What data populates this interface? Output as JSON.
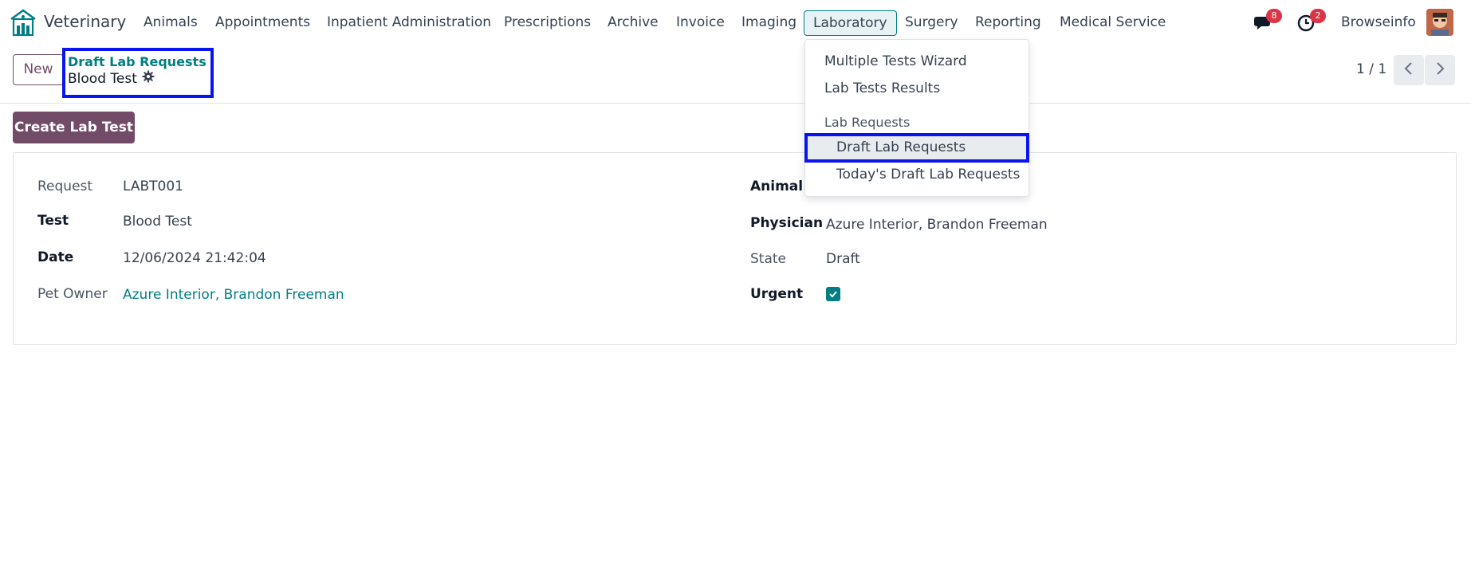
{
  "navbar": {
    "app_name": "Veterinary",
    "menu": [
      "Animals",
      "Appointments",
      "Inpatient Administration",
      "Prescriptions",
      "Archive",
      "Invoice",
      "Imaging",
      "Laboratory",
      "Surgery",
      "Reporting",
      "Medical Service"
    ],
    "active_menu": "Laboratory",
    "messages_count": "8",
    "activities_count": "2",
    "company": "Browseinfo"
  },
  "control_panel": {
    "new_label": "New",
    "breadcrumb_parent": "Draft Lab Requests",
    "breadcrumb_current": "Blood Test",
    "pager": "1 / 1"
  },
  "actions": {
    "create_lab_test": "Create Lab Test"
  },
  "form": {
    "request_label": "Request",
    "request_value": "LABT001",
    "test_label": "Test",
    "test_value": "Blood Test",
    "date_label": "Date",
    "date_value": "12/06/2024 21:42:04",
    "pet_owner_label": "Pet Owner",
    "pet_owner_value": "Azure Interior, Brandon Freeman",
    "animal_label": "Animal",
    "physician_label": "Physician",
    "physician_value": "Azure Interior, Brandon Freeman",
    "state_label": "State",
    "state_value": "Draft",
    "urgent_label": "Urgent",
    "urgent_checked": true
  },
  "dropdown": {
    "items": [
      "Multiple Tests Wizard",
      "Lab Tests Results"
    ],
    "section": "Lab Requests",
    "sub_items": [
      "Draft Lab Requests",
      "Today's Draft Lab Requests"
    ]
  },
  "colors": {
    "brand": "#714b67",
    "link": "#017e84",
    "highlight_border": "#0a14f0",
    "badge": "#dc3545"
  }
}
